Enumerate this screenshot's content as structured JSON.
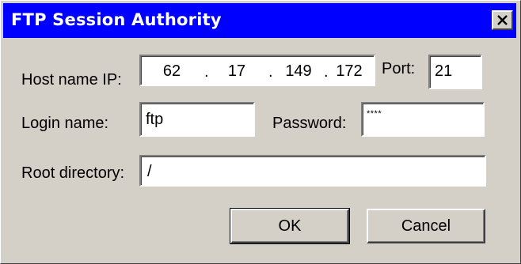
{
  "window": {
    "title": "FTP Session Authority",
    "close_glyph": "close-icon"
  },
  "form": {
    "host_label": "Host name IP:",
    "host_ip": [
      "62",
      "17",
      "149",
      "172"
    ],
    "ip_separator": ".",
    "port_label": "Port:",
    "port_value": "21",
    "login_label": "Login name:",
    "login_value": "ftp",
    "password_label": "Password:",
    "password_value": "****",
    "root_label": "Root directory:",
    "root_value": "/"
  },
  "buttons": {
    "ok_label": "OK",
    "cancel_label": "Cancel"
  },
  "colors": {
    "titlebar": "#0000ff",
    "face": "#d4d0c8"
  }
}
